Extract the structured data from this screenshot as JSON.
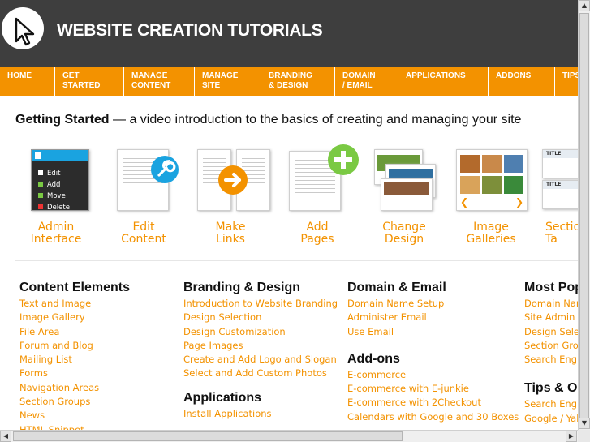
{
  "header": {
    "title": "WEBSITE CREATION TUTORIALS"
  },
  "nav": [
    {
      "label": "HOME"
    },
    {
      "label": "GET\nSTARTED"
    },
    {
      "label": "MANAGE\nCONTENT"
    },
    {
      "label": "MANAGE\nSITE"
    },
    {
      "label": "BRANDING\n& DESIGN"
    },
    {
      "label": "DOMAIN\n/ EMAIL"
    },
    {
      "label": "APPLICATIONS"
    },
    {
      "label": "ADDONS"
    },
    {
      "label": "TIPS"
    }
  ],
  "intro": {
    "bold": "Getting Started",
    "rest": " — a video introduction to the basics of creating and managing your site"
  },
  "thumbs": [
    {
      "label": "Admin\nInterface",
      "menu": [
        "Edit",
        "Add",
        "Move",
        "Delete"
      ]
    },
    {
      "label": "Edit\nContent"
    },
    {
      "label": "Make\nLinks"
    },
    {
      "label": "Add\nPages"
    },
    {
      "label": "Change\nDesign"
    },
    {
      "label": "Image\nGalleries"
    },
    {
      "label": "Sectio\nTa",
      "badge": "TITLE"
    }
  ],
  "columns": {
    "content": {
      "heading": "Content Elements",
      "links": [
        "Text and Image",
        "Image Gallery",
        "File Area",
        "Forum and Blog",
        "Mailing List",
        "Forms",
        "Navigation Areas",
        "Section Groups",
        "News",
        "HTML Snippet"
      ]
    },
    "branding": {
      "heading": "Branding & Design",
      "links": [
        "Introduction to Website Branding",
        "Design Selection",
        "Design Customization",
        "Page Images",
        "Create and Add Logo and Slogan",
        "Select and Add Custom Photos"
      ],
      "heading2": "Applications",
      "links2": [
        "Install Applications"
      ]
    },
    "domain": {
      "heading": "Domain & Email",
      "links": [
        "Domain Name Setup",
        "Administer Email",
        "Use Email"
      ],
      "heading2": "Add-ons",
      "links2": [
        "E-commerce",
        "E-commerce with E-junkie",
        "E-commerce with 2Checkout",
        "Calendars with Google and 30 Boxes"
      ]
    },
    "popular": {
      "heading": "Most Pop",
      "links": [
        "Domain Nam",
        "Site Admin I",
        "Design Selec",
        "Section Grou",
        "Search Engi"
      ],
      "heading2": "Tips & O",
      "links2": [
        "Search Engi",
        "Google / Yah"
      ]
    }
  },
  "colors": {
    "header_bg": "#3e3e3e",
    "accent": "#f39200",
    "green": "#7ac943",
    "blue": "#1aa3e0"
  }
}
